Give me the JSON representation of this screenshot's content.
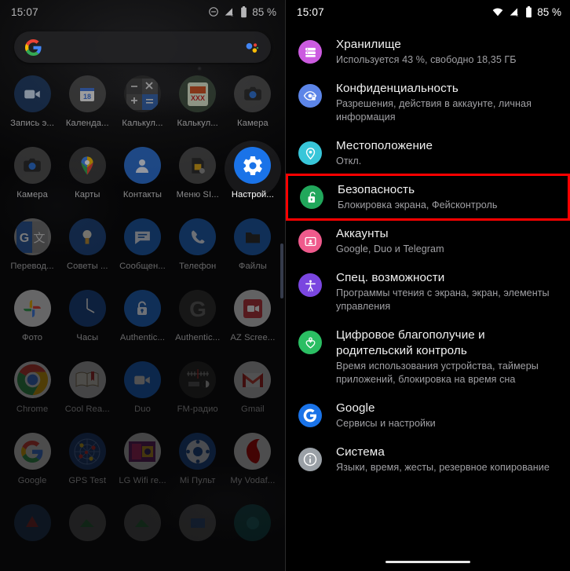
{
  "left_phone": {
    "status_bar": {
      "time": "15:07",
      "battery_percent": "85 %",
      "icons": [
        "do-not-disturb-icon",
        "signal-off-icon",
        "battery-icon"
      ]
    },
    "search_bar": {
      "placeholder": "",
      "left_icon": "google-logo-icon",
      "right_icon": "google-assistant-icon"
    },
    "apps": [
      {
        "label": "Запись э...",
        "icon": "screen-recorder-icon",
        "dim": "dim3"
      },
      {
        "label": "Календа...",
        "icon": "google-calendar-icon",
        "dim": "dim3"
      },
      {
        "label": "Калькул...",
        "icon": "calculator-icon",
        "dim": "dim3"
      },
      {
        "label": "Калькул...",
        "icon": "xxx-calculator-icon",
        "dim": "dim3"
      },
      {
        "label": "Камера",
        "icon": "camera-icon",
        "dim": "dim3"
      },
      {
        "label": "Камера",
        "icon": "camera-icon",
        "dim": "dim3"
      },
      {
        "label": "Карты",
        "icon": "google-maps-icon",
        "dim": "dim3"
      },
      {
        "label": "Контакты",
        "icon": "contacts-icon",
        "dim": "dim3"
      },
      {
        "label": "Меню SI...",
        "icon": "sim-menu-icon",
        "dim": "dim3"
      },
      {
        "label": "Настрой...",
        "icon": "settings-gear-icon",
        "dim": "none",
        "highlighted": true
      },
      {
        "label": "Перевод...",
        "icon": "google-translate-icon",
        "dim": "dim2"
      },
      {
        "label": "Советы ...",
        "icon": "tips-bulb-icon",
        "dim": "dim2"
      },
      {
        "label": "Сообщен...",
        "icon": "messages-icon",
        "dim": "dim2"
      },
      {
        "label": "Телефон",
        "icon": "phone-icon",
        "dim": "dim2"
      },
      {
        "label": "Файлы",
        "icon": "files-folder-icon",
        "dim": "dim2"
      },
      {
        "label": "Фото",
        "icon": "google-photos-icon",
        "dim": "dim2"
      },
      {
        "label": "Часы",
        "icon": "clock-icon",
        "dim": "dim2"
      },
      {
        "label": "Authentic...",
        "icon": "authenticator-lock-icon",
        "dim": "dim2"
      },
      {
        "label": "Authentic...",
        "icon": "authenticator-g-icon",
        "dim": "dim2"
      },
      {
        "label": "AZ Scree...",
        "icon": "az-screen-recorder-icon",
        "dim": "dim2"
      },
      {
        "label": "Chrome",
        "icon": "chrome-icon",
        "dim": "dim"
      },
      {
        "label": "Cool Rea...",
        "icon": "coolreader-book-icon",
        "dim": "dim"
      },
      {
        "label": "Duo",
        "icon": "google-duo-icon",
        "dim": "dim"
      },
      {
        "label": "FM-радио",
        "icon": "fm-radio-icon",
        "dim": "dim"
      },
      {
        "label": "Gmail",
        "icon": "gmail-icon",
        "dim": "dim"
      },
      {
        "label": "Google",
        "icon": "google-app-icon",
        "dim": "dim"
      },
      {
        "label": "GPS Test",
        "icon": "gps-test-icon",
        "dim": "dim"
      },
      {
        "label": "LG Wifi re...",
        "icon": "lg-wifi-remote-icon",
        "dim": "dim"
      },
      {
        "label": "Mi Пульт",
        "icon": "mi-remote-icon",
        "dim": "dim"
      },
      {
        "label": "My Vodaf...",
        "icon": "vodafone-icon",
        "dim": "dim"
      },
      {
        "label": "",
        "icon": "app-partial-1-icon",
        "dim": "dim"
      },
      {
        "label": "",
        "icon": "app-partial-2-icon",
        "dim": "dim"
      },
      {
        "label": "",
        "icon": "app-partial-3-icon",
        "dim": "dim"
      },
      {
        "label": "",
        "icon": "app-partial-4-icon",
        "dim": "dim"
      },
      {
        "label": "",
        "icon": "app-partial-5-icon",
        "dim": "dim"
      }
    ]
  },
  "right_phone": {
    "status_bar": {
      "time": "15:07",
      "battery_percent": "85 %",
      "icons": [
        "wifi-icon",
        "signal-off-icon",
        "battery-icon"
      ]
    },
    "settings_items": [
      {
        "title": "Хранилище",
        "subtitle": "Используется 43 %, свободно 18,35 ГБ",
        "icon": "storage-icon",
        "color": "#CC5BE0",
        "selected": false
      },
      {
        "title": "Конфиденциальность",
        "subtitle": "Разрешения, действия в аккаунте, личная информация",
        "icon": "privacy-eye-lock-icon",
        "color": "#5C85E8",
        "selected": false
      },
      {
        "title": "Местоположение",
        "subtitle": "Откл.",
        "icon": "location-pin-icon",
        "color": "#38C6D9",
        "selected": false
      },
      {
        "title": "Безопасность",
        "subtitle": "Блокировка экрана, Фейсконтроль",
        "icon": "security-unlock-icon",
        "color": "#21A75B",
        "selected": true
      },
      {
        "title": "Аккаунты",
        "subtitle": "Google, Duo и Telegram",
        "icon": "accounts-person-card-icon",
        "color": "#EF5A8C",
        "selected": false
      },
      {
        "title": "Спец. возможности",
        "subtitle": "Программы чтения с экрана, экран, элементы управления",
        "icon": "accessibility-icon",
        "color": "#7A46E0",
        "selected": false
      },
      {
        "title": "Цифровое благополучие и родительский контроль",
        "subtitle": "Время использования устройства, таймеры приложений, блокировка на время сна",
        "icon": "digital-wellbeing-heart-icon",
        "color": "#2BBE63",
        "selected": false
      },
      {
        "title": "Google",
        "subtitle": "Сервисы и настройки",
        "icon": "google-g-icon",
        "color": "#1A73E8",
        "selected": false
      },
      {
        "title": "Система",
        "subtitle": "Языки, время, жесты, резервное копирование",
        "icon": "system-info-icon",
        "color": "#9AA0A6",
        "selected": false
      }
    ],
    "highlight_color": "#ff0000"
  }
}
